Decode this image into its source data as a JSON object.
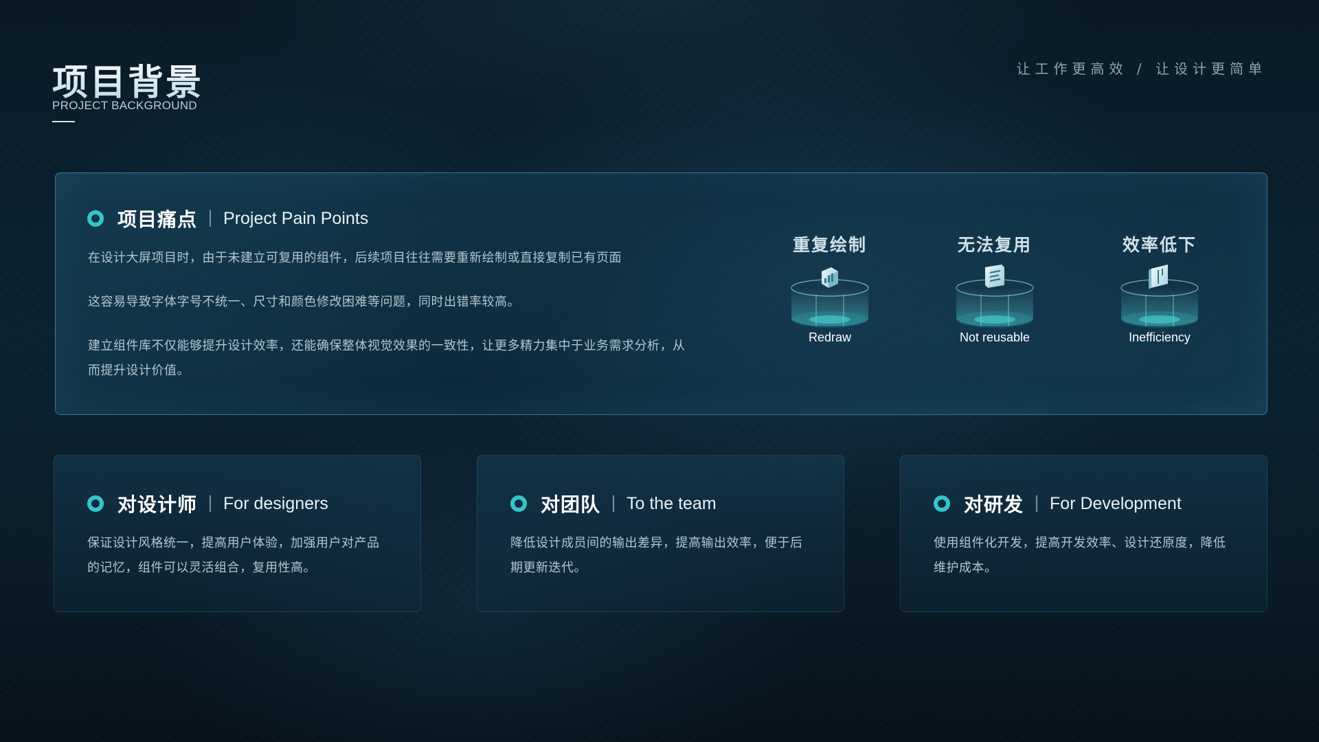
{
  "header": {
    "title": "项目背景",
    "subtitle": "PROJECT BACKGROUND",
    "tagline": "让工作更高效 / 让设计更简单"
  },
  "pain_points": {
    "title_cn": "项目痛点",
    "title_en": "Project Pain Points",
    "paragraphs": [
      "在设计大屏项目时，由于未建立可复用的组件，后续项目往往需要重新绘制或直接复制已有页面",
      "这容易导致字体字号不统一、尺寸和颜色修改困难等问题，同时出错率较高。",
      "建立组件库不仅能够提升设计效率，还能确保整体视觉效果的一致性，让更多精力集中于业务需求分析，从而提升设计价值。"
    ],
    "items": [
      {
        "label_cn": "重复绘制",
        "label_en": "Redraw",
        "icon": "chart-icon"
      },
      {
        "label_cn": "无法复用",
        "label_en": "Not reusable",
        "icon": "document-icon"
      },
      {
        "label_cn": "效率低下",
        "label_en": "Inefficiency",
        "icon": "book-icon"
      }
    ]
  },
  "audiences": [
    {
      "title_cn": "对设计师",
      "title_en": "For designers",
      "text": "保证设计风格统一，提高用户体验，加强用户对产品的记忆，组件可以灵活组合，复用性高。"
    },
    {
      "title_cn": "对团队",
      "title_en": "To the team",
      "text": "降低设计成员间的输出差异，提高输出效率，便于后期更新迭代。"
    },
    {
      "title_cn": "对研发",
      "title_en": "For Development",
      "text": "使用组件化开发，提高开发效率、设计还原度，降低维护成本。"
    }
  ],
  "colors": {
    "accent": "#33c6cc",
    "background": "#0b2231",
    "card_border": "#68b0cc"
  }
}
